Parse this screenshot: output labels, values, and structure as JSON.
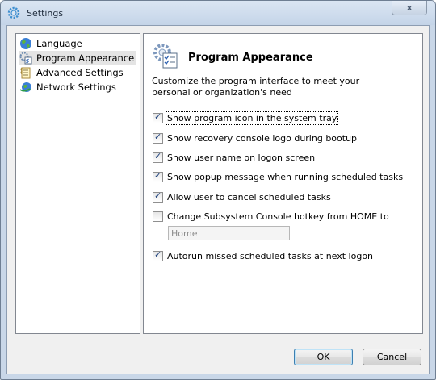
{
  "window": {
    "title": "Settings",
    "close_label": "x"
  },
  "sidebar": {
    "items": [
      {
        "label": "Language",
        "icon": "globe-icon",
        "selected": false
      },
      {
        "label": "Program Appearance",
        "icon": "appearance-icon",
        "selected": true
      },
      {
        "label": "Advanced Settings",
        "icon": "notepad-icon",
        "selected": false
      },
      {
        "label": "Network Settings",
        "icon": "network-globe-icon",
        "selected": false
      }
    ]
  },
  "panel": {
    "title": "Program Appearance",
    "description": "Customize the program interface to meet your personal or organization's need",
    "options": [
      {
        "label": "Show program icon in the system tray",
        "checked": true
      },
      {
        "label": "Show recovery console logo during bootup",
        "checked": true
      },
      {
        "label": "Show user name on logon screen",
        "checked": true
      },
      {
        "label": "Show popup message when running scheduled tasks",
        "checked": true
      },
      {
        "label": "Allow user to cancel scheduled tasks",
        "checked": true
      },
      {
        "label": "Change Subsystem Console hotkey from HOME to",
        "checked": false
      },
      {
        "label": "Autorun missed scheduled tasks at next logon",
        "checked": true
      }
    ],
    "hotkey_value": "Home"
  },
  "buttons": {
    "ok_label": "OK",
    "cancel_label": "Cancel"
  }
}
